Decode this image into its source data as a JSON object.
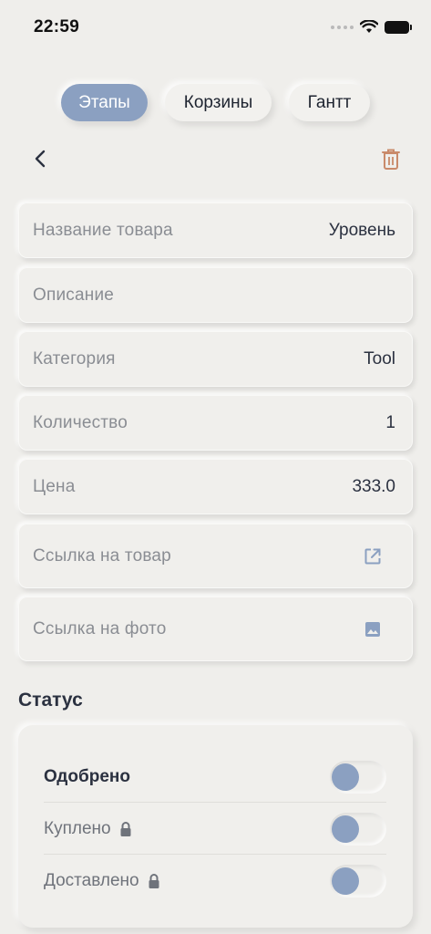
{
  "status_bar": {
    "time": "22:59"
  },
  "tabs": [
    {
      "label": "Этапы",
      "active": true
    },
    {
      "label": "Корзины",
      "active": false
    },
    {
      "label": "Гантт",
      "active": false
    }
  ],
  "header": {
    "back_icon": "chevron-left-icon",
    "delete_icon": "trash-icon"
  },
  "fields": {
    "name": {
      "label": "Название товара",
      "value": "Уровень"
    },
    "description": {
      "label": "Описание",
      "value": ""
    },
    "category": {
      "label": "Категория",
      "value": "Tool"
    },
    "quantity": {
      "label": "Количество",
      "value": "1"
    },
    "price": {
      "label": "Цена",
      "value": "333.0"
    },
    "product_link": {
      "label": "Ссылка на товар",
      "icon": "open-in-new-icon"
    },
    "photo_link": {
      "label": "Ссылка на фото",
      "icon": "image-icon"
    }
  },
  "status": {
    "title": "Статус",
    "items": [
      {
        "label": "Одобрено",
        "locked": false,
        "on": false
      },
      {
        "label": "Куплено",
        "locked": true,
        "on": false
      },
      {
        "label": "Доставлено",
        "locked": true,
        "on": false
      }
    ]
  },
  "colors": {
    "accent": "#8ba0c1",
    "background": "#efeeeb",
    "trash": "#c98a6a"
  }
}
